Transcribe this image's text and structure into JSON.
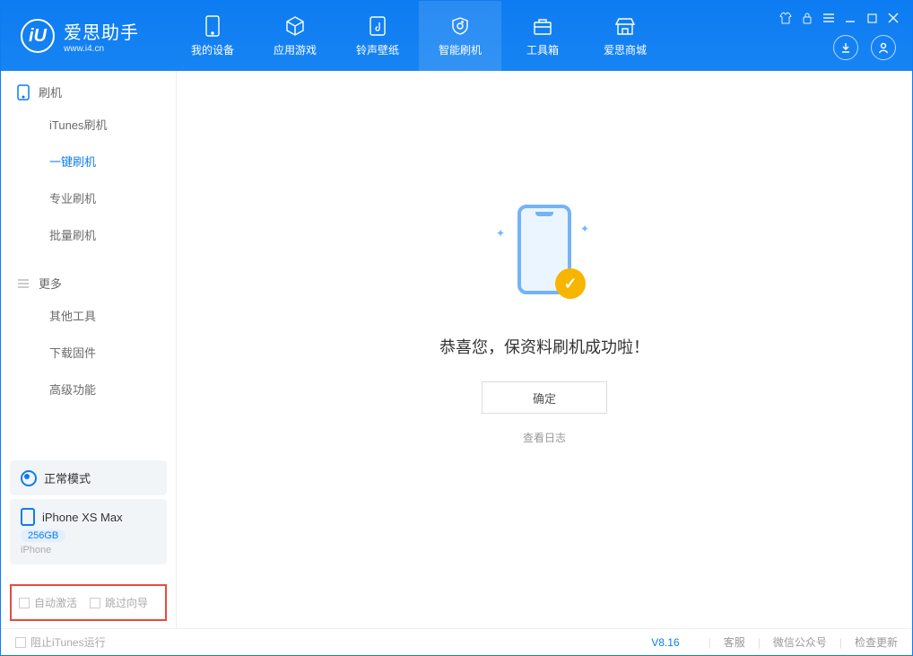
{
  "logo": {
    "title": "爱思助手",
    "subtitle": "www.i4.cn",
    "glyph": "iU"
  },
  "tabs": [
    {
      "label": "我的设备"
    },
    {
      "label": "应用游戏"
    },
    {
      "label": "铃声壁纸"
    },
    {
      "label": "智能刷机"
    },
    {
      "label": "工具箱"
    },
    {
      "label": "爱思商城"
    }
  ],
  "sidebar": {
    "section1": {
      "title": "刷机",
      "items": [
        "iTunes刷机",
        "一键刷机",
        "专业刷机",
        "批量刷机"
      ],
      "active_index": 1
    },
    "section2": {
      "title": "更多",
      "items": [
        "其他工具",
        "下载固件",
        "高级功能"
      ]
    }
  },
  "device": {
    "mode_label": "正常模式",
    "name": "iPhone XS Max",
    "capacity": "256GB",
    "type": "iPhone"
  },
  "options": {
    "auto_activate": "自动激活",
    "skip_guide": "跳过向导"
  },
  "main": {
    "success_msg": "恭喜您，保资料刷机成功啦！",
    "ok_btn": "确定",
    "log_link": "查看日志"
  },
  "statusbar": {
    "block_itunes": "阻止iTunes运行",
    "version": "V8.16",
    "links": [
      "客服",
      "微信公众号",
      "检查更新"
    ]
  }
}
